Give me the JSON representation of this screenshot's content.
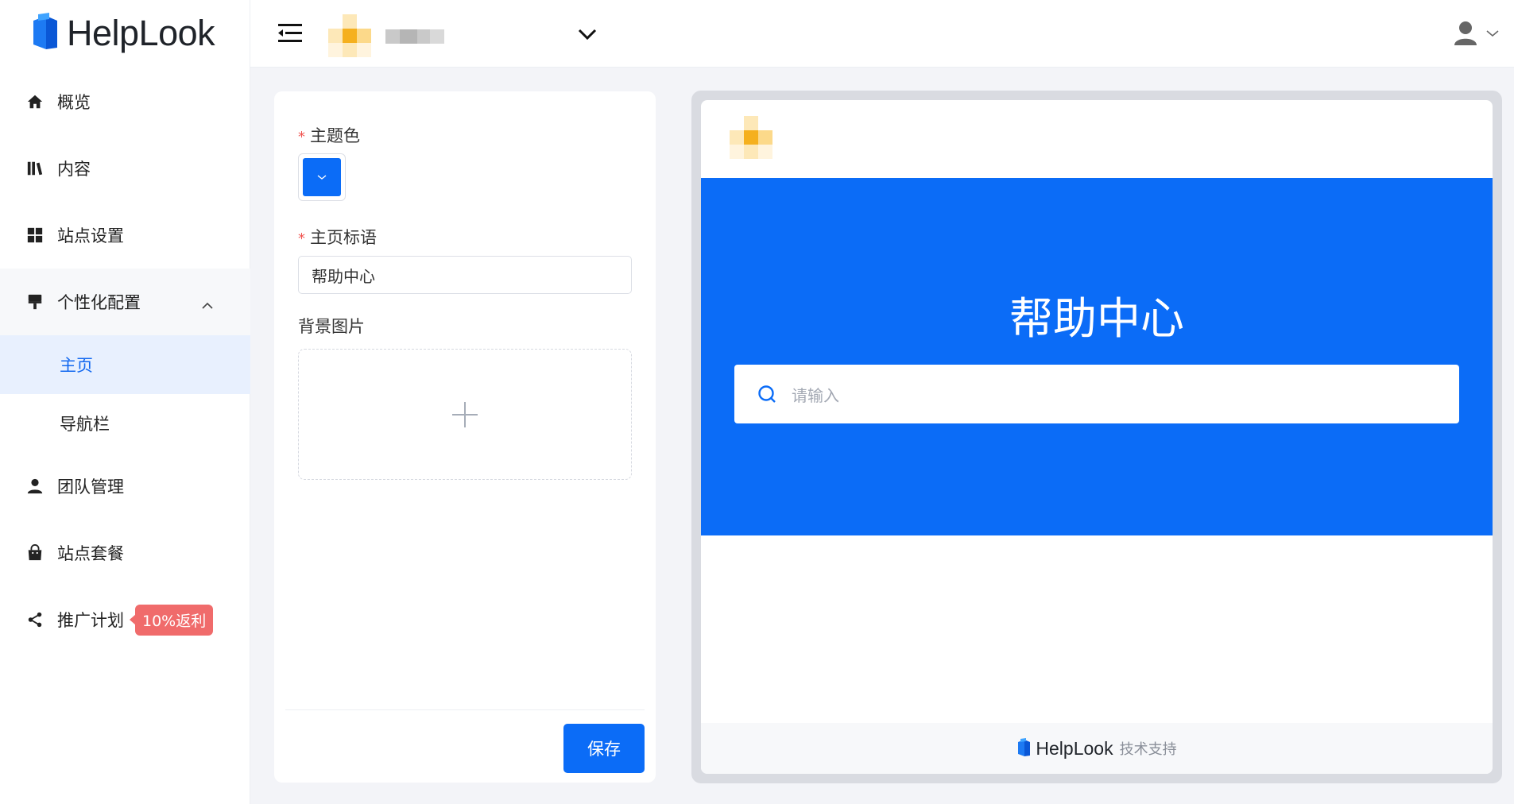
{
  "brand": {
    "name": "HelpLook"
  },
  "sidebar": {
    "items": [
      {
        "label": "概览",
        "icon": "home-icon"
      },
      {
        "label": "内容",
        "icon": "book-icon"
      },
      {
        "label": "站点设置",
        "icon": "grid-icon"
      },
      {
        "label": "个性化配置",
        "icon": "paint-brush-icon",
        "expanded": true,
        "children": [
          {
            "label": "主页",
            "active": true
          },
          {
            "label": "导航栏",
            "active": false
          }
        ]
      },
      {
        "label": "团队管理",
        "icon": "user-icon"
      },
      {
        "label": "站点套餐",
        "icon": "shopping-bag-icon"
      },
      {
        "label": "推广计划",
        "icon": "share-icon",
        "badge": "10%返利"
      }
    ]
  },
  "form": {
    "theme_color_label": "主题色",
    "theme_color_value": "#0b6cf7",
    "homepage_slogan_label": "主页标语",
    "homepage_slogan_value": "帮助中心",
    "background_image_label": "背景图片",
    "save_label": "保存"
  },
  "preview": {
    "hero_title": "帮助中心",
    "search_placeholder": "请输入",
    "footer_brand": "HelpLook",
    "footer_tech": "技术支持"
  },
  "colors": {
    "accent": "#0b6cf7",
    "badge": "#f06b6b",
    "required": "#f0534f",
    "active_bg": "#e8f0fe"
  }
}
